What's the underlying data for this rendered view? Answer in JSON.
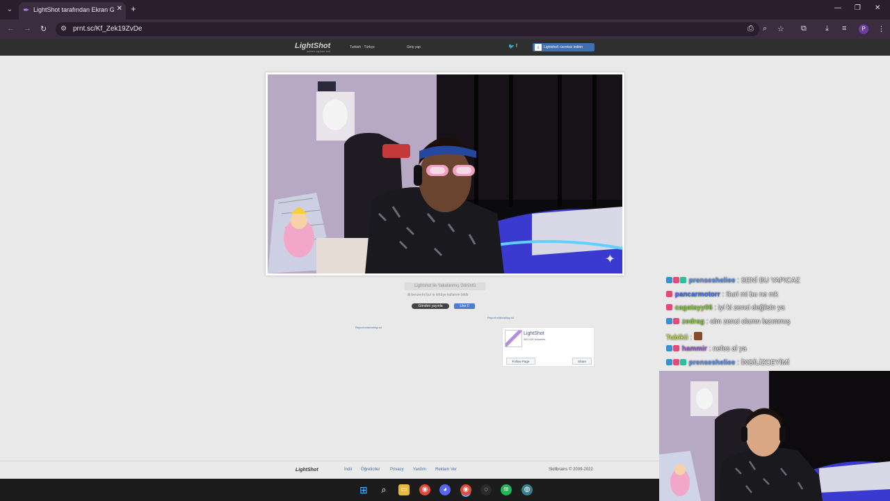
{
  "browser": {
    "tab_title": "LightShot tarafından Ekran Görüntüsü",
    "url": "prnt.sc/Kf_Zek19ZvDe",
    "profile_initial": "P"
  },
  "lightshot": {
    "logo": "LightShot",
    "logo_sub": "screen capture tool",
    "language": "Turkish - Türkçe",
    "login": "Giriş yap",
    "download_label": "Lightshot'ı ücretsiz indirin",
    "caption_title": "Lightshot ile Yakalanmış Görüntü",
    "caption_links": "⊠ benzerini bul   ⊚ kötüye kullanım bildir",
    "tweet_button": "Gönderi yayınla",
    "like_button": "Like 0",
    "report_label": "Report misleading ad",
    "fb_widget": {
      "name": "LightShot",
      "followers": "383,416 followers",
      "follow": "Follow Page",
      "share": "Share"
    },
    "footer": {
      "logo": "LightShot",
      "links": [
        "İndir",
        "Öğreticiler",
        "Privacy",
        "Yardım",
        "Reklam Ver"
      ],
      "copyright": "Skillbrains © 2009-2022"
    }
  },
  "chat": [
    {
      "user": "prensesheliee",
      "message": ": SENİ BU YAPICAZ",
      "color": "#5a8dff"
    },
    {
      "user": "pancarmotorr",
      "message": ": Suri mi bu ne mk",
      "color": "#3b6bff"
    },
    {
      "user": "cagatayy06",
      "message": ": iyi ki zenci değilsin ya",
      "color": "#8bc34a"
    },
    {
      "user": "zedrag",
      "message": ": olm zenci olamn lazımmış",
      "color": "#8bc34a"
    },
    {
      "user": "Tubikii",
      "message": ":",
      "color": "#c6d84a"
    },
    {
      "user": "hammir",
      "message": ": nefes al ya",
      "color": "#9b59d0"
    },
    {
      "user": "prensesheliee",
      "message": ": İNGİLİZCEYİMİ",
      "color": "#5a8dff"
    }
  ],
  "colors": {
    "chrome_dark": "#2a1d2e",
    "chrome_mid": "#3c2c40",
    "ls_header": "#2f2f2f",
    "ls_blue": "#3f6fb0"
  }
}
